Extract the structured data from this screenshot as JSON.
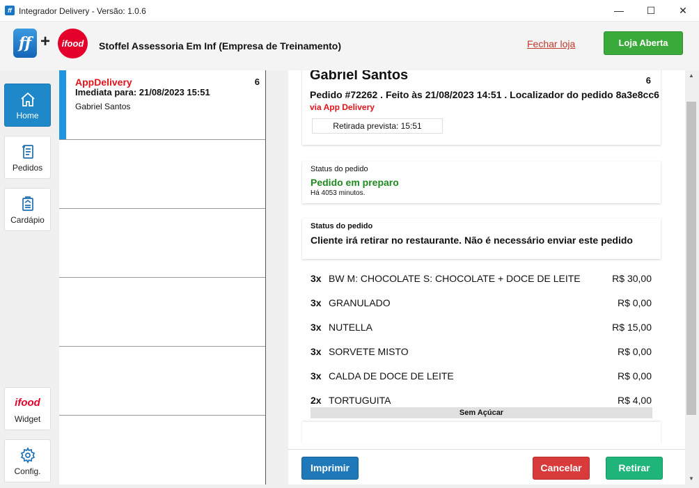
{
  "window": {
    "title": "Integrador Delivery - Versão: 1.0.6",
    "app_icon": "ff",
    "minimize": "—",
    "maximize": "☐",
    "close": "✕"
  },
  "header": {
    "logo_ff": "ff",
    "plus": "+",
    "logo_ifood": "ifood",
    "company": "Stoffel Assessoria Em Inf (Empresa de Treinamento)",
    "close_store": "Fechar loja",
    "store_status": "Loja Aberta"
  },
  "sidebar": {
    "items": [
      {
        "label": "Home",
        "icon": "home-icon"
      },
      {
        "label": "Pedidos",
        "icon": "receipt-icon"
      },
      {
        "label": "Cardápio",
        "icon": "menu-book-icon"
      },
      {
        "label": "Widget",
        "icon": "ifood-logo",
        "logo": "ifood"
      },
      {
        "label": "Config.",
        "icon": "gear-icon"
      }
    ]
  },
  "orders": [
    {
      "source": "AppDelivery",
      "number": "6",
      "time": "Imediata para: 21/08/2023 15:51",
      "customer": "Gabriel Santos"
    }
  ],
  "detail": {
    "customer": "Gabriel Santos",
    "number": "6",
    "order_line": "Pedido #72262 . Feito às 21/08/2023 14:51 . Localizador do pedido 8a3e8cc6",
    "via": "via App Delivery",
    "pickup": "Retirada prevista: 15:51",
    "status_label": "Status do pedido",
    "status_value": "Pedido em preparo",
    "status_ago": "Há 4053 minutos.",
    "delivery_label": "Status do pedido",
    "delivery_value": "Cliente irá retirar no restaurante. Não é necessário enviar este pedido",
    "items": [
      {
        "qty": "3x",
        "name": "BW M: CHOCOLATE S: CHOCOLATE + DOCE DE LEITE",
        "price": "R$ 30,00"
      },
      {
        "qty": "3x",
        "name": "GRANULADO",
        "price": "R$ 0,00"
      },
      {
        "qty": "3x",
        "name": "NUTELLA",
        "price": "R$ 15,00"
      },
      {
        "qty": "3x",
        "name": "SORVETE MISTO",
        "price": "R$ 0,00"
      },
      {
        "qty": "3x",
        "name": "CALDA DE DOCE DE LEITE",
        "price": "R$ 0,00"
      },
      {
        "qty": "2x",
        "name": "TORTUGUITA",
        "price": "R$ 4,00"
      }
    ],
    "note": "Sem Açúcar"
  },
  "actions": {
    "print": "Imprimir",
    "cancel": "Cancelar",
    "pickup": "Retirar"
  },
  "scrollbar": {
    "up": "▲",
    "down": "▼"
  },
  "colors": {
    "accent": "#1e88c8",
    "ifood_red": "#e4002b",
    "ok_green": "#3aab3a",
    "cancel_red": "#d93a3a",
    "pickup_green": "#1fb57a"
  }
}
